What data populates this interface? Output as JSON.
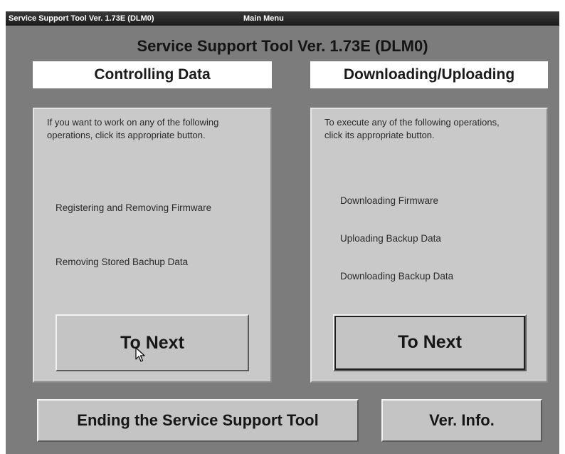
{
  "window": {
    "title_app": "Service Support Tool Ver. 1.73E (DLM0)",
    "title_screen": "Main Menu"
  },
  "heading": "Service Support Tool Ver. 1.73E (DLM0)",
  "left_panel": {
    "label": "Controlling Data",
    "description": "If you want to work on any of the following operations, click its appropriate button.",
    "operations": [
      "Registering and Removing Firmware",
      "Removing Stored Bachup Data"
    ],
    "button_label": "To Next"
  },
  "right_panel": {
    "label": "Downloading/Uploading",
    "description": "To execute any of the following operations, click its appropriate button.",
    "operations": [
      "Downloading Firmware",
      "Uploading Backup Data",
      "Downloading Backup Data"
    ],
    "button_label": "To Next"
  },
  "bottom": {
    "end_label": "Ending the Service Support Tool",
    "version_label": "Ver. Info."
  },
  "icons": {
    "cursor": "mouse-pointer-icon"
  }
}
